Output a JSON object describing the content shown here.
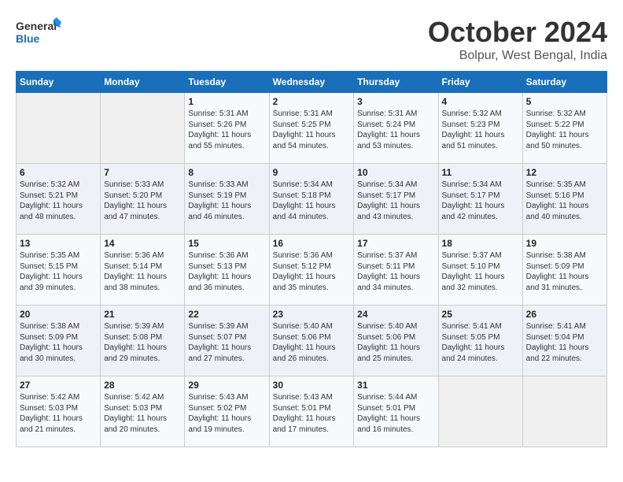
{
  "header": {
    "logo_general": "General",
    "logo_blue": "Blue",
    "month_title": "October 2024",
    "location": "Bolpur, West Bengal, India"
  },
  "weekdays": [
    "Sunday",
    "Monday",
    "Tuesday",
    "Wednesday",
    "Thursday",
    "Friday",
    "Saturday"
  ],
  "weeks": [
    [
      {
        "day": "",
        "sunrise": "",
        "sunset": "",
        "daylight": ""
      },
      {
        "day": "",
        "sunrise": "",
        "sunset": "",
        "daylight": ""
      },
      {
        "day": "1",
        "sunrise": "Sunrise: 5:31 AM",
        "sunset": "Sunset: 5:26 PM",
        "daylight": "Daylight: 11 hours and 55 minutes."
      },
      {
        "day": "2",
        "sunrise": "Sunrise: 5:31 AM",
        "sunset": "Sunset: 5:25 PM",
        "daylight": "Daylight: 11 hours and 54 minutes."
      },
      {
        "day": "3",
        "sunrise": "Sunrise: 5:31 AM",
        "sunset": "Sunset: 5:24 PM",
        "daylight": "Daylight: 11 hours and 53 minutes."
      },
      {
        "day": "4",
        "sunrise": "Sunrise: 5:32 AM",
        "sunset": "Sunset: 5:23 PM",
        "daylight": "Daylight: 11 hours and 51 minutes."
      },
      {
        "day": "5",
        "sunrise": "Sunrise: 5:32 AM",
        "sunset": "Sunset: 5:22 PM",
        "daylight": "Daylight: 11 hours and 50 minutes."
      }
    ],
    [
      {
        "day": "6",
        "sunrise": "Sunrise: 5:32 AM",
        "sunset": "Sunset: 5:21 PM",
        "daylight": "Daylight: 11 hours and 48 minutes."
      },
      {
        "day": "7",
        "sunrise": "Sunrise: 5:33 AM",
        "sunset": "Sunset: 5:20 PM",
        "daylight": "Daylight: 11 hours and 47 minutes."
      },
      {
        "day": "8",
        "sunrise": "Sunrise: 5:33 AM",
        "sunset": "Sunset: 5:19 PM",
        "daylight": "Daylight: 11 hours and 46 minutes."
      },
      {
        "day": "9",
        "sunrise": "Sunrise: 5:34 AM",
        "sunset": "Sunset: 5:18 PM",
        "daylight": "Daylight: 11 hours and 44 minutes."
      },
      {
        "day": "10",
        "sunrise": "Sunrise: 5:34 AM",
        "sunset": "Sunset: 5:17 PM",
        "daylight": "Daylight: 11 hours and 43 minutes."
      },
      {
        "day": "11",
        "sunrise": "Sunrise: 5:34 AM",
        "sunset": "Sunset: 5:17 PM",
        "daylight": "Daylight: 11 hours and 42 minutes."
      },
      {
        "day": "12",
        "sunrise": "Sunrise: 5:35 AM",
        "sunset": "Sunset: 5:16 PM",
        "daylight": "Daylight: 11 hours and 40 minutes."
      }
    ],
    [
      {
        "day": "13",
        "sunrise": "Sunrise: 5:35 AM",
        "sunset": "Sunset: 5:15 PM",
        "daylight": "Daylight: 11 hours and 39 minutes."
      },
      {
        "day": "14",
        "sunrise": "Sunrise: 5:36 AM",
        "sunset": "Sunset: 5:14 PM",
        "daylight": "Daylight: 11 hours and 38 minutes."
      },
      {
        "day": "15",
        "sunrise": "Sunrise: 5:36 AM",
        "sunset": "Sunset: 5:13 PM",
        "daylight": "Daylight: 11 hours and 36 minutes."
      },
      {
        "day": "16",
        "sunrise": "Sunrise: 5:36 AM",
        "sunset": "Sunset: 5:12 PM",
        "daylight": "Daylight: 11 hours and 35 minutes."
      },
      {
        "day": "17",
        "sunrise": "Sunrise: 5:37 AM",
        "sunset": "Sunset: 5:11 PM",
        "daylight": "Daylight: 11 hours and 34 minutes."
      },
      {
        "day": "18",
        "sunrise": "Sunrise: 5:37 AM",
        "sunset": "Sunset: 5:10 PM",
        "daylight": "Daylight: 11 hours and 32 minutes."
      },
      {
        "day": "19",
        "sunrise": "Sunrise: 5:38 AM",
        "sunset": "Sunset: 5:09 PM",
        "daylight": "Daylight: 11 hours and 31 minutes."
      }
    ],
    [
      {
        "day": "20",
        "sunrise": "Sunrise: 5:38 AM",
        "sunset": "Sunset: 5:09 PM",
        "daylight": "Daylight: 11 hours and 30 minutes."
      },
      {
        "day": "21",
        "sunrise": "Sunrise: 5:39 AM",
        "sunset": "Sunset: 5:08 PM",
        "daylight": "Daylight: 11 hours and 29 minutes."
      },
      {
        "day": "22",
        "sunrise": "Sunrise: 5:39 AM",
        "sunset": "Sunset: 5:07 PM",
        "daylight": "Daylight: 11 hours and 27 minutes."
      },
      {
        "day": "23",
        "sunrise": "Sunrise: 5:40 AM",
        "sunset": "Sunset: 5:06 PM",
        "daylight": "Daylight: 11 hours and 26 minutes."
      },
      {
        "day": "24",
        "sunrise": "Sunrise: 5:40 AM",
        "sunset": "Sunset: 5:06 PM",
        "daylight": "Daylight: 11 hours and 25 minutes."
      },
      {
        "day": "25",
        "sunrise": "Sunrise: 5:41 AM",
        "sunset": "Sunset: 5:05 PM",
        "daylight": "Daylight: 11 hours and 24 minutes."
      },
      {
        "day": "26",
        "sunrise": "Sunrise: 5:41 AM",
        "sunset": "Sunset: 5:04 PM",
        "daylight": "Daylight: 11 hours and 22 minutes."
      }
    ],
    [
      {
        "day": "27",
        "sunrise": "Sunrise: 5:42 AM",
        "sunset": "Sunset: 5:03 PM",
        "daylight": "Daylight: 11 hours and 21 minutes."
      },
      {
        "day": "28",
        "sunrise": "Sunrise: 5:42 AM",
        "sunset": "Sunset: 5:03 PM",
        "daylight": "Daylight: 11 hours and 20 minutes."
      },
      {
        "day": "29",
        "sunrise": "Sunrise: 5:43 AM",
        "sunset": "Sunset: 5:02 PM",
        "daylight": "Daylight: 11 hours and 19 minutes."
      },
      {
        "day": "30",
        "sunrise": "Sunrise: 5:43 AM",
        "sunset": "Sunset: 5:01 PM",
        "daylight": "Daylight: 11 hours and 17 minutes."
      },
      {
        "day": "31",
        "sunrise": "Sunrise: 5:44 AM",
        "sunset": "Sunset: 5:01 PM",
        "daylight": "Daylight: 11 hours and 16 minutes."
      },
      {
        "day": "",
        "sunrise": "",
        "sunset": "",
        "daylight": ""
      },
      {
        "day": "",
        "sunrise": "",
        "sunset": "",
        "daylight": ""
      }
    ]
  ]
}
